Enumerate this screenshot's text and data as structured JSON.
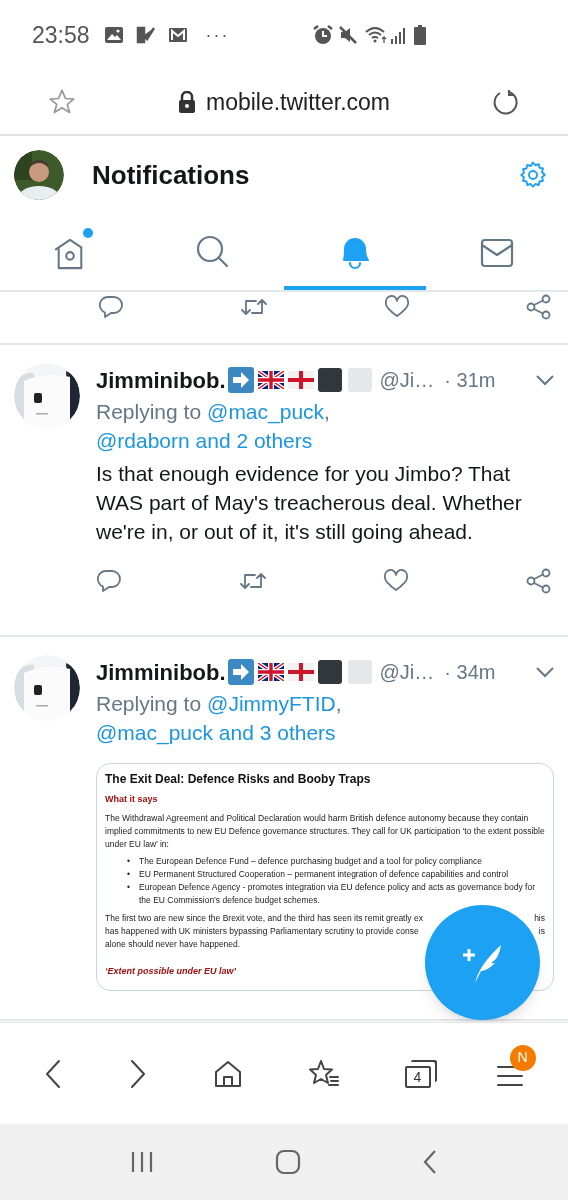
{
  "status_bar": {
    "time": "23:58",
    "more": "···"
  },
  "url_bar": {
    "url": "mobile.twitter.com",
    "secure": true
  },
  "header": {
    "title": "Notifications"
  },
  "tabs": [
    {
      "kind": "home",
      "selected": false,
      "unread": true
    },
    {
      "kind": "search",
      "selected": false,
      "unread": false
    },
    {
      "kind": "notifications",
      "selected": true,
      "unread": false
    },
    {
      "kind": "messages",
      "selected": false,
      "unread": false
    }
  ],
  "tweets": [
    {
      "name": "Jimminibob.",
      "handle": "@Ji…",
      "time": "· 31m",
      "replying_prefix": "Replying to",
      "separator": ",",
      "reply_to": [
        "@mac_puck",
        "@rdaborn and 2 others"
      ],
      "text": "Is that enough evidence for you Jimbo? That WAS part of May's treacherous deal. Whether we're in, or out of it, it's still going ahead."
    },
    {
      "name": "Jimminibob.",
      "handle": "@Ji…",
      "time": "· 34m",
      "replying_prefix": "Replying to",
      "separator": ",",
      "reply_to": [
        "@JimmyFTID",
        "@mac_puck and 3 others"
      ],
      "document": {
        "title": "The Exit Deal: Defence Risks and Booby Traps",
        "heading": "What it says",
        "intro": "The Withdrawal Agreement and Political Declaration would harm British defence autonomy because they contain implied commitments to new EU Defence governance structures. They call for UK participation ‘to the extent possible under EU law’ in:",
        "bullet_mark": "•",
        "bullets": [
          "The European Defence Fund – defence purchasing budget and a tool for policy compliance",
          "EU Permanent Structured Cooperation – permanent integration of defence capabilities and control",
          "European Defence Agency - promotes integration via EU defence policy and acts as governance body for the EU Commission’s defence budget schemes."
        ],
        "closing_lines": [
          {
            "left": "The first two are new since the Brexit vote, and the third has seen its remit greatly ex",
            "right": "his"
          },
          {
            "left": "has happened with UK ministers bypassing Parliamentary scrutiny to provide conse",
            "right": "is"
          },
          {
            "left": "alone should never have happened."
          }
        ],
        "subheading": "‘Extent possible under EU law’"
      }
    }
  ],
  "bottom_bar": [
    {
      "kind": "back"
    },
    {
      "kind": "forward"
    },
    {
      "kind": "home"
    },
    {
      "kind": "bookmarks"
    },
    {
      "kind": "tabs",
      "label": "4"
    },
    {
      "kind": "menu",
      "badge": "N"
    }
  ]
}
